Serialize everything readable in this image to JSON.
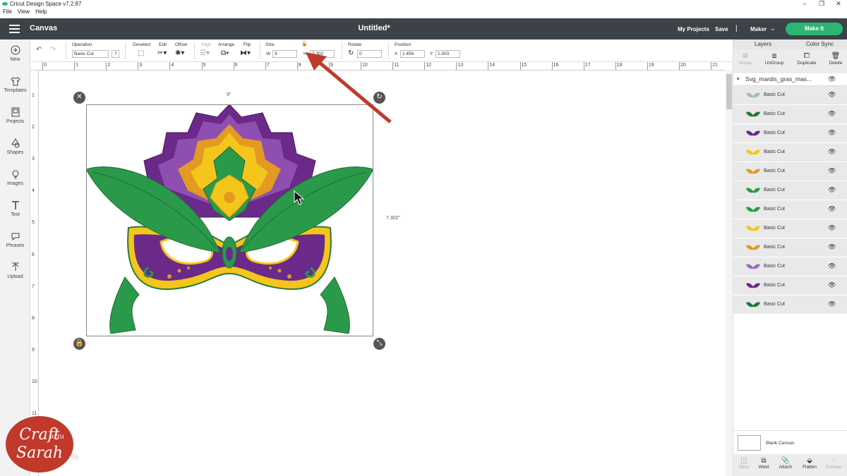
{
  "window": {
    "title": "Cricut Design Space  v7.2.87",
    "controls": [
      "–",
      "❐",
      "✕"
    ]
  },
  "menu": [
    "File",
    "View",
    "Help"
  ],
  "header": {
    "section": "Canvas",
    "doc_title": "Untitled*",
    "my_projects": "My Projects",
    "save": "Save",
    "separator": "|",
    "machine": "Maker",
    "make_it": "Make It"
  },
  "left_tools": [
    {
      "label": "New",
      "icon": "plus-circle-icon"
    },
    {
      "label": "Templates",
      "icon": "shirt-icon"
    },
    {
      "label": "Projects",
      "icon": "projects-icon"
    },
    {
      "label": "Shapes",
      "icon": "shapes-icon"
    },
    {
      "label": "Images",
      "icon": "bulb-icon"
    },
    {
      "label": "Text",
      "icon": "text-icon"
    },
    {
      "label": "Phrases",
      "icon": "speech-icon"
    },
    {
      "label": "Upload",
      "icon": "upload-icon"
    }
  ],
  "toolbar": {
    "operation_label": "Operation",
    "operation_value": "Basic Cut",
    "help": "?",
    "deselect": "Deselect",
    "edit": "Edit",
    "offset": "Offset",
    "align": "Align",
    "arrange": "Arrange",
    "flip": "Flip",
    "size_label": "Size",
    "w_label": "W",
    "w_value": "9",
    "h_label": "H",
    "h_value": "7.302",
    "rotate_label": "Rotate",
    "rotate_value": "0",
    "position_label": "Position",
    "x_label": "X",
    "x_value": "1.456",
    "y_label": "Y",
    "y_value": "1.003"
  },
  "ruler": {
    "h": [
      "0",
      "1",
      "2",
      "3",
      "4",
      "5",
      "6",
      "7",
      "8",
      "9",
      "10",
      "11",
      "12",
      "13",
      "14",
      "15",
      "16",
      "17",
      "18",
      "19",
      "20",
      "21"
    ],
    "v": [
      "1",
      "2",
      "3",
      "4",
      "5",
      "6",
      "7",
      "8",
      "9",
      "10",
      "11"
    ]
  },
  "canvas": {
    "width_label": "9\"",
    "height_label": "7.302\"",
    "zoom": "%"
  },
  "colors": {
    "green": "#2a9a4a",
    "dark_green": "#1e7a3a",
    "purple": "#6b2a8a",
    "light_purple": "#8e4fb0",
    "yellow": "#f4c51a",
    "orange": "#e39a22",
    "make_it": "#2bb673",
    "header": "#3c4247"
  },
  "right_panel": {
    "tabs": [
      "Layers",
      "Color Sync"
    ],
    "actions": [
      "Group",
      "UnGroup",
      "Duplicate",
      "Delete"
    ],
    "group_name": "Svg_mardis_gras_mas...",
    "layers": [
      {
        "label": "Basic Cut",
        "color": "#9bc4a8"
      },
      {
        "label": "Basic Cut",
        "color": "#1e7a3a"
      },
      {
        "label": "Basic Cut",
        "color": "#6b2a8a"
      },
      {
        "label": "Basic Cut",
        "color": "#f4c51a"
      },
      {
        "label": "Basic Cut",
        "color": "#e39a22"
      },
      {
        "label": "Basic Cut",
        "color": "#2a9a4a"
      },
      {
        "label": "Basic Cut",
        "color": "#2a9a4a"
      },
      {
        "label": "Basic Cut",
        "color": "#f4c51a"
      },
      {
        "label": "Basic Cut",
        "color": "#e39a22"
      },
      {
        "label": "Basic Cut",
        "color": "#9b6bc0"
      },
      {
        "label": "Basic Cut",
        "color": "#6b2a8a"
      },
      {
        "label": "Basic Cut",
        "color": "#1e7a3a"
      }
    ],
    "blank_canvas": "Blank Canvas",
    "bottom_actions": [
      "Slice",
      "Weld",
      "Attach",
      "Flatten",
      "Contour"
    ]
  },
  "watermark": {
    "line1": "Craft",
    "line2": "Sarah",
    "with": "WITH"
  }
}
